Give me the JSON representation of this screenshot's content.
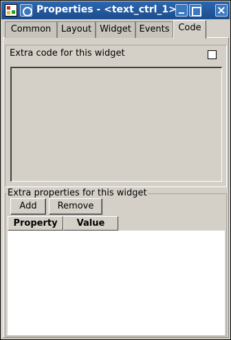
{
  "window": {
    "title": "Properties - <text_ctrl_1>"
  },
  "tabs": [
    {
      "label": "Common"
    },
    {
      "label": "Layout"
    },
    {
      "label": "Widget"
    },
    {
      "label": "Events"
    },
    {
      "label": "Code",
      "active": true
    }
  ],
  "code_section": {
    "label": "Extra code for this widget",
    "checkbox_checked": false,
    "code_value": ""
  },
  "properties_section": {
    "legend": "Extra properties for this widget",
    "add_label": "Add",
    "remove_label": "Remove",
    "columns": [
      "Property",
      "Value"
    ],
    "rows": []
  },
  "icons": {
    "app": "app-icon",
    "window_menu": "window-menu-icon",
    "minimize": "minimize-icon",
    "maximize": "maximize-icon",
    "close": "close-icon"
  },
  "colors": {
    "titlebar": "#1c4d8c",
    "face": "#d4d0c8"
  }
}
